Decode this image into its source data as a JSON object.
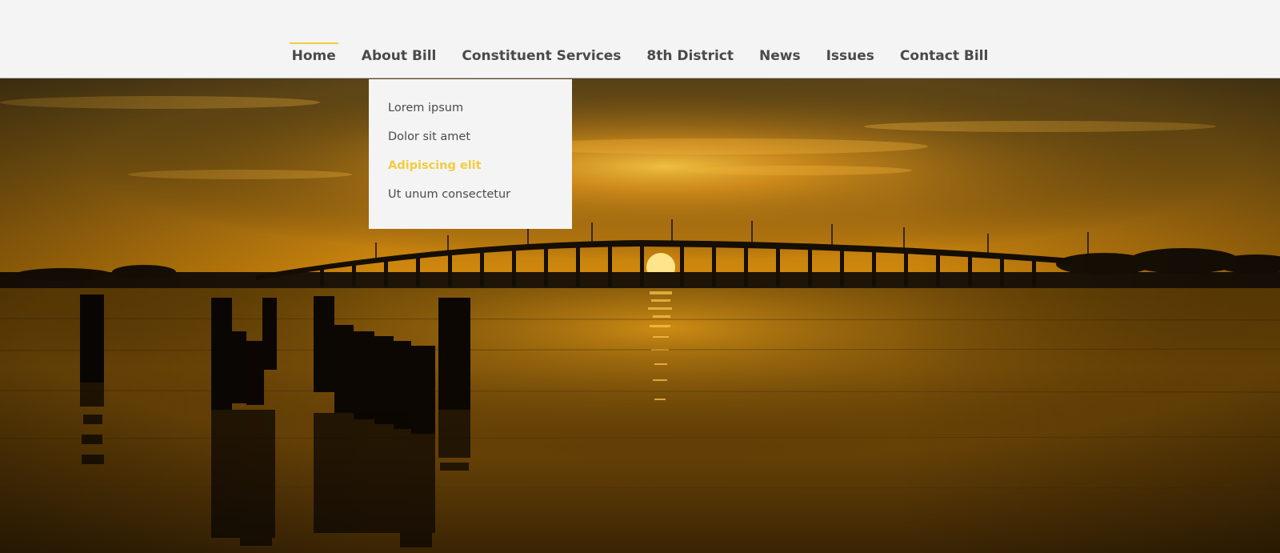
{
  "colors": {
    "accent": "#f2cc3f",
    "nav_text": "#4a4a4a",
    "nav_background": "#f4f4f4"
  },
  "nav": {
    "items": [
      {
        "label": "Home",
        "active": true
      },
      {
        "label": "About Bill",
        "active": false
      },
      {
        "label": "Constituent Services",
        "active": false
      },
      {
        "label": "8th District",
        "active": false
      },
      {
        "label": "News",
        "active": false
      },
      {
        "label": "Issues",
        "active": false
      },
      {
        "label": "Contact Bill",
        "active": false
      }
    ]
  },
  "dropdown": {
    "parent": "About Bill",
    "items": [
      {
        "label": "Lorem ipsum",
        "highlighted": false
      },
      {
        "label": "Dolor sit amet",
        "highlighted": false
      },
      {
        "label": "Adipiscing elit",
        "highlighted": true
      },
      {
        "label": "Ut unum consectetur",
        "highlighted": false
      }
    ]
  },
  "hero": {
    "image": "sunset-bridge-over-water-photo"
  }
}
